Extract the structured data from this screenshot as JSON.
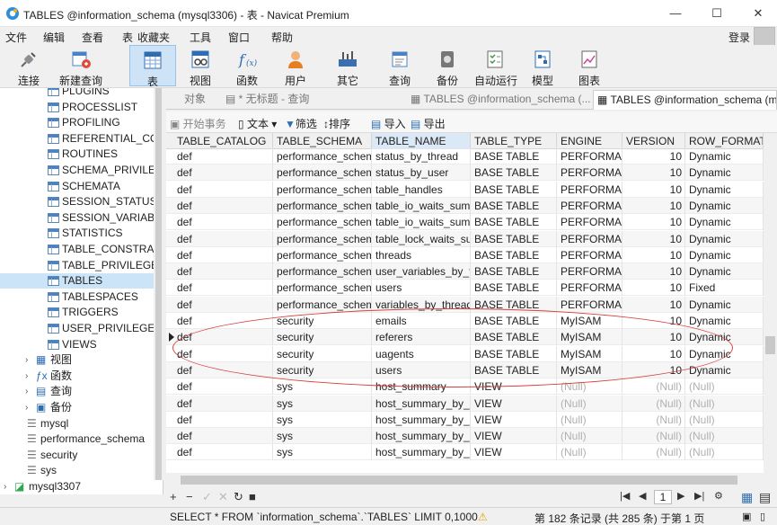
{
  "window": {
    "title": "TABLES @information_schema (mysql3306) - 表 - Navicat Premium",
    "minimize": "—",
    "maximize": "☐",
    "close": "✕"
  },
  "menu": [
    "文件",
    "编辑",
    "查看",
    "表",
    "收藏夹",
    "工具",
    "窗口",
    "帮助"
  ],
  "login": "登录",
  "toolbar": [
    {
      "label": "连接",
      "icon": "plug-icon"
    },
    {
      "label": "新建查询",
      "icon": "new-query-icon"
    },
    {
      "label": "表",
      "icon": "table-icon"
    },
    {
      "label": "视图",
      "icon": "view-icon"
    },
    {
      "label": "函数",
      "icon": "function-icon"
    },
    {
      "label": "用户",
      "icon": "user-icon"
    },
    {
      "label": "其它",
      "icon": "tools-icon"
    },
    {
      "label": "查询",
      "icon": "query-icon"
    },
    {
      "label": "备份",
      "icon": "backup-icon"
    },
    {
      "label": "自动运行",
      "icon": "schedule-icon"
    },
    {
      "label": "模型",
      "icon": "model-icon"
    },
    {
      "label": "图表",
      "icon": "chart-icon"
    }
  ],
  "sidebar": {
    "tables": [
      "PLUGINS",
      "PROCESSLIST",
      "PROFILING",
      "REFERENTIAL_CON",
      "ROUTINES",
      "SCHEMA_PRIVILEG",
      "SCHEMATA",
      "SESSION_STATUS",
      "SESSION_VARIABL",
      "STATISTICS",
      "TABLE_CONSTRAIN",
      "TABLE_PRIVILEGES",
      "TABLES",
      "TABLESPACES",
      "TRIGGERS",
      "USER_PRIVILEGES",
      "VIEWS"
    ],
    "selected": "TABLES",
    "groups": [
      "视图",
      "函数",
      "查询",
      "备份"
    ],
    "databases": [
      "mysql",
      "performance_schema",
      "security",
      "sys"
    ],
    "connection": "mysql3307"
  },
  "tabs": [
    "对象",
    "* 无标题 - 查询",
    "TABLES @information_schema (...",
    "TABLES @information_schema (my"
  ],
  "subtoolbar": {
    "begin": "开始事务",
    "text": "文本",
    "filter": "筛选",
    "sort": "排序",
    "import": "导入",
    "export": "导出"
  },
  "columns": [
    "TABLE_CATALOG",
    "TABLE_SCHEMA",
    "TABLE_NAME",
    "TABLE_TYPE",
    "ENGINE",
    "VERSION",
    "ROW_FORMAT"
  ],
  "rows": [
    [
      "def",
      "performance_schem",
      "status_by_thread",
      "BASE TABLE",
      "PERFORMANC",
      "10",
      "Dynamic"
    ],
    [
      "def",
      "performance_schem",
      "status_by_user",
      "BASE TABLE",
      "PERFORMANC",
      "10",
      "Dynamic"
    ],
    [
      "def",
      "performance_schem",
      "table_handles",
      "BASE TABLE",
      "PERFORMANC",
      "10",
      "Dynamic"
    ],
    [
      "def",
      "performance_schem",
      "table_io_waits_summ",
      "BASE TABLE",
      "PERFORMANC",
      "10",
      "Dynamic"
    ],
    [
      "def",
      "performance_schem",
      "table_io_waits_summ",
      "BASE TABLE",
      "PERFORMANC",
      "10",
      "Dynamic"
    ],
    [
      "def",
      "performance_schem",
      "table_lock_waits_sun",
      "BASE TABLE",
      "PERFORMANC",
      "10",
      "Dynamic"
    ],
    [
      "def",
      "performance_schem",
      "threads",
      "BASE TABLE",
      "PERFORMANC",
      "10",
      "Dynamic"
    ],
    [
      "def",
      "performance_schem",
      "user_variables_by_th",
      "BASE TABLE",
      "PERFORMANC",
      "10",
      "Dynamic"
    ],
    [
      "def",
      "performance_schem",
      "users",
      "BASE TABLE",
      "PERFORMANC",
      "10",
      "Fixed"
    ],
    [
      "def",
      "performance_schem",
      "variables_by_thread",
      "BASE TABLE",
      "PERFORMANC",
      "10",
      "Dynamic"
    ],
    [
      "def",
      "security",
      "emails",
      "BASE TABLE",
      "MyISAM",
      "10",
      "Dynamic"
    ],
    [
      "def",
      "security",
      "referers",
      "BASE TABLE",
      "MyISAM",
      "10",
      "Dynamic"
    ],
    [
      "def",
      "security",
      "uagents",
      "BASE TABLE",
      "MyISAM",
      "10",
      "Dynamic"
    ],
    [
      "def",
      "security",
      "users",
      "BASE TABLE",
      "MyISAM",
      "10",
      "Dynamic"
    ],
    [
      "def",
      "sys",
      "host_summary",
      "VIEW",
      "(Null)",
      "(Null)",
      "(Null)"
    ],
    [
      "def",
      "sys",
      "host_summary_by_fil",
      "VIEW",
      "(Null)",
      "(Null)",
      "(Null)"
    ],
    [
      "def",
      "sys",
      "host_summary_by_st",
      "VIEW",
      "(Null)",
      "(Null)",
      "(Null)"
    ],
    [
      "def",
      "sys",
      "host_summary_by_st",
      "VIEW",
      "(Null)",
      "(Null)",
      "(Null)"
    ],
    [
      "def",
      "sys",
      "host_summary_by_st",
      "VIEW",
      "(Null)",
      "(Null)",
      "(Null)"
    ]
  ],
  "current_row": 11,
  "bottombar": {
    "page": "1"
  },
  "status": {
    "sql": "SELECT * FROM `information_schema`.`TABLES` LIMIT 0,1000",
    "record": "第 182 条记录 (共 285 条) 于第 1 页"
  }
}
